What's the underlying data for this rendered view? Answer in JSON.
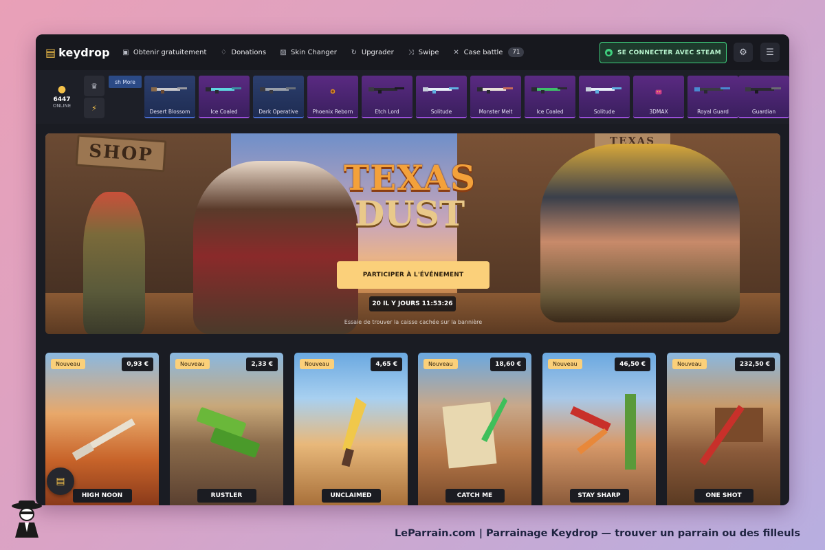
{
  "nav": {
    "logo": "keydrop",
    "items": [
      {
        "label": "Obtenir gratuitement",
        "icon": "gift-icon"
      },
      {
        "label": "Donations",
        "icon": "donation-icon"
      },
      {
        "label": "Skin Changer",
        "icon": "skin-changer-icon"
      },
      {
        "label": "Upgrader",
        "icon": "upgrader-icon"
      },
      {
        "label": "Swipe",
        "icon": "swipe-icon"
      },
      {
        "label": "Case battle",
        "icon": "swords-icon",
        "count": "71"
      }
    ],
    "steam_button": "SE CONNECTER AVEC STEAM"
  },
  "drops": {
    "online_count": "6447",
    "online_label": "ONLINE",
    "more_tab": "sh More",
    "items": [
      {
        "name": "Desert Blossom",
        "rarity": "blue"
      },
      {
        "name": "Ice Coaled",
        "rarity": "purple"
      },
      {
        "name": "Dark Operative",
        "rarity": "blue"
      },
      {
        "name": "Phoenix Reborn",
        "rarity": "purple"
      },
      {
        "name": "Etch Lord",
        "rarity": "purple"
      },
      {
        "name": "Solitude",
        "rarity": "purple"
      },
      {
        "name": "Monster Melt",
        "rarity": "purple"
      },
      {
        "name": "Ice Coaled",
        "rarity": "purple"
      },
      {
        "name": "Solitude",
        "rarity": "purple"
      },
      {
        "name": "3DMAX",
        "rarity": "purple"
      },
      {
        "name": "Royal Guard",
        "rarity": "purple"
      },
      {
        "name": "Guardian",
        "rarity": "purple"
      }
    ]
  },
  "hero": {
    "shop_sign": "SHOP",
    "saloon_sign": "TEXAS",
    "title_line1": "TEXAS",
    "title_line2": "DUST",
    "cta": "PARTICIPER À L'ÉVÉNEMENT",
    "timer": "20 IL Y JOURS 11:53:26",
    "hint": "Essaie de trouver la caisse cachée sur la bannière"
  },
  "cases": [
    {
      "tag": "Nouveau",
      "price": "0,93 €",
      "name": "HIGH NOON"
    },
    {
      "tag": "Nouveau",
      "price": "2,33 €",
      "name": "RUSTLER"
    },
    {
      "tag": "Nouveau",
      "price": "4,65 €",
      "name": "UNCLAIMED"
    },
    {
      "tag": "Nouveau",
      "price": "18,60 €",
      "name": "CATCH ME"
    },
    {
      "tag": "Nouveau",
      "price": "46,50 €",
      "name": "STAY SHARP"
    },
    {
      "tag": "Nouveau",
      "price": "232,50 €",
      "name": "ONE SHOT"
    }
  ],
  "footer": {
    "caption": "LeParrain.com | Parrainage Keydrop — trouver un parrain ou des filleuls"
  },
  "colors": {
    "accent_yellow": "#fbd07a",
    "steam_green": "#3fd17e",
    "rarity_blue": "#4b6dd1",
    "rarity_purple": "#9a4fd9"
  }
}
